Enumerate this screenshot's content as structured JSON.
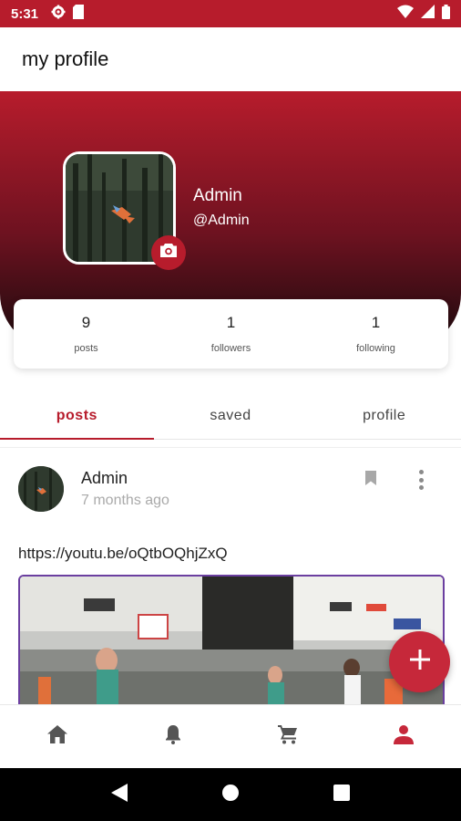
{
  "status_bar": {
    "time": "5:31"
  },
  "app_bar": {
    "title": "my profile"
  },
  "profile": {
    "name": "Admin",
    "handle": "@Admin"
  },
  "stats": [
    {
      "value": "9",
      "label": "posts"
    },
    {
      "value": "1",
      "label": "followers"
    },
    {
      "value": "1",
      "label": "following"
    }
  ],
  "tabs": [
    {
      "label": "posts",
      "active": true
    },
    {
      "label": "saved",
      "active": false
    },
    {
      "label": "profile",
      "active": false
    }
  ],
  "post": {
    "author": "Admin",
    "time": "7 months ago",
    "text": "https://youtu.be/oQtbOQhjZxQ"
  },
  "bottom_nav": [
    "home-icon",
    "bell-icon",
    "cart-icon",
    "person-icon"
  ],
  "colors": {
    "accent": "#b71c2c",
    "fab": "#c6283a",
    "inactive_icon": "#555555"
  }
}
